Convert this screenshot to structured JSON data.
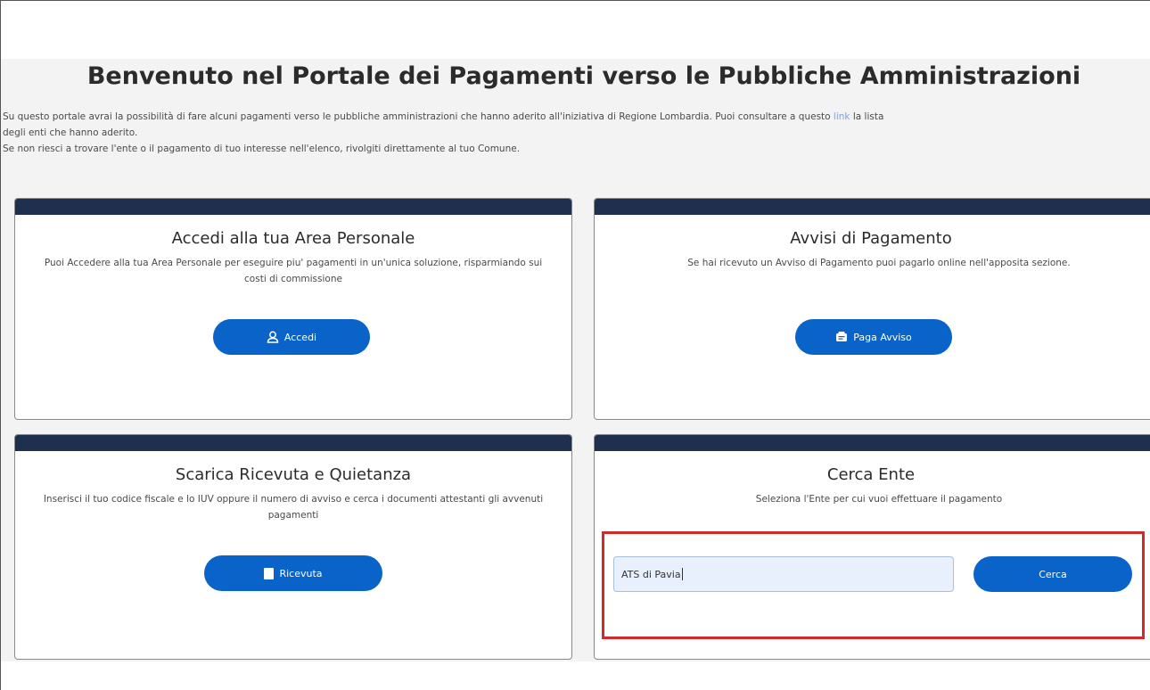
{
  "page": {
    "title": "Benvenuto nel Portale dei Pagamenti verso le Pubbliche Amministrazioni",
    "intro_line1_before": "Su questo portale avrai la possibilità di fare alcuni pagamenti verso le pubbliche amministrazioni che hanno aderito all'iniziativa di Regione Lombardia. Puoi consultare a questo ",
    "intro_link": "link",
    "intro_line1_after": " la lista",
    "intro_line2": "degli enti che hanno aderito.",
    "intro_line3": "Se non riesci a trovare l'ente o il pagamento di tuo interesse nell'elenco, rivolgiti direttamente al tuo Comune."
  },
  "cards": {
    "area_personale": {
      "title": "Accedi alla tua Area Personale",
      "description": "Puoi Accedere alla tua Area Personale per eseguire piu' pagamenti in un'unica soluzione, risparmiando sui costi di commissione",
      "button_label": "Accedi",
      "button_icon": "user-icon"
    },
    "avvisi": {
      "title": "Avvisi di Pagamento",
      "description": "Se hai ricevuto un Avviso di Pagamento puoi pagarlo online nell'apposita sezione.",
      "button_label": "Paga Avviso",
      "button_icon": "invoice-icon"
    },
    "ricevuta": {
      "title": "Scarica Ricevuta e Quietanza",
      "description": "Inserisci il tuo codice fiscale e lo IUV oppure il numero di avviso e cerca i documenti attestanti gli avvenuti pagamenti",
      "button_label": "Ricevuta",
      "button_icon": "document-icon"
    },
    "cerca_ente": {
      "title": "Cerca Ente",
      "description": "Seleziona l'Ente per cui vuoi effettuare il pagamento",
      "input_value": "ATS di Pavia",
      "button_label": "Cerca"
    }
  },
  "colors": {
    "card_header": "#1f2f4e",
    "primary_button": "#0a63c9",
    "highlight": "#d12a2a",
    "input_background": "#e8f0fe"
  }
}
